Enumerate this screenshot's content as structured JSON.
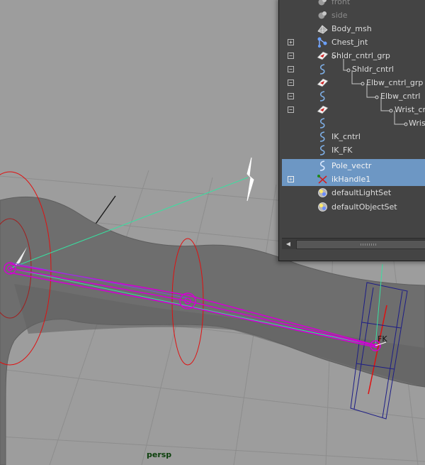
{
  "viewport": {
    "camera": "persp",
    "fk_label": "FK"
  },
  "outliner": {
    "rows": [
      {
        "label": "front",
        "icon": "camera-icon",
        "state": "dim"
      },
      {
        "label": "side",
        "icon": "camera-icon",
        "state": "dim"
      },
      {
        "label": "Body_msh",
        "icon": "mesh-icon"
      },
      {
        "label": "Chest_jnt",
        "icon": "joint-icon",
        "expander": "+"
      },
      {
        "label": "Shldr_cntrl_grp",
        "icon": "group-icon",
        "expander": "−"
      },
      {
        "label": "Shldr_cntrl",
        "icon": "curve-icon",
        "expander": "−"
      },
      {
        "label": "Elbw_cntrl_grp",
        "icon": "group-icon",
        "expander": "−"
      },
      {
        "label": "Elbw_cntrl",
        "icon": "curve-icon",
        "expander": "−"
      },
      {
        "label": "Wrist_cntrl",
        "icon": "group-icon",
        "expander": "−"
      },
      {
        "label": "Wrist_",
        "icon": "curve-icon"
      },
      {
        "label": "IK_cntrl",
        "icon": "curve-icon"
      },
      {
        "label": "IK_FK",
        "icon": "curve-icon"
      },
      {
        "label": "Pole_vectr",
        "icon": "curve-icon",
        "selected": true
      },
      {
        "label": "ikHandle1",
        "icon": "ik-handle-icon",
        "expander": "+",
        "selected": true
      },
      {
        "label": "defaultLightSet",
        "icon": "set-icon"
      },
      {
        "label": "defaultObjectSet",
        "icon": "set-icon"
      }
    ]
  },
  "colors": {
    "viewport_bg": "#9d9d9d",
    "grid": "#8e8e8e",
    "selection": "#6d97c4",
    "joint": "#d200d2",
    "control": "#e01010",
    "handle": "#38e0a0"
  }
}
